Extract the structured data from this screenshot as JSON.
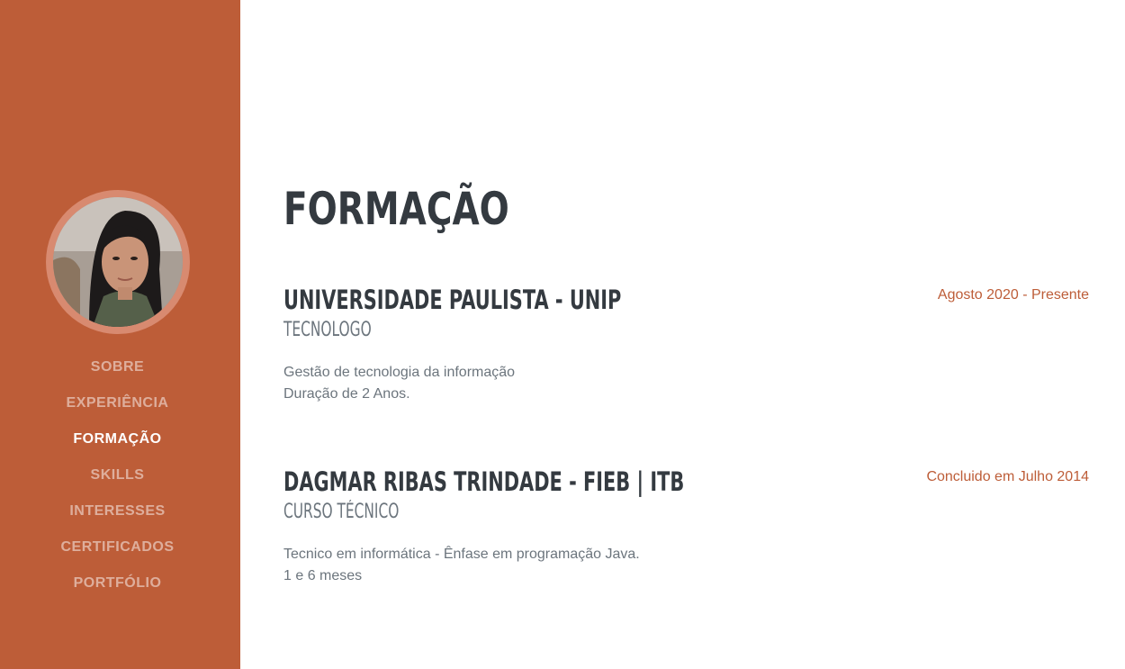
{
  "sidebar": {
    "avatar_alt": "profile photo",
    "nav": [
      {
        "label": "SOBRE"
      },
      {
        "label": "EXPERIÊNCIA"
      },
      {
        "label": "FORMAÇÃO"
      },
      {
        "label": "SKILLS"
      },
      {
        "label": "INTERESSES"
      },
      {
        "label": "CERTIFICADOS"
      },
      {
        "label": "PORTFÓLIO"
      }
    ],
    "active_index": 2
  },
  "main": {
    "title": "FORMAÇÃO",
    "entries": [
      {
        "school": "UNIVERSIDADE PAULISTA - UNIP",
        "degree": "TECNOLOGO",
        "line1": "Gestão de tecnologia da informação",
        "line2": "Duração de 2 Anos.",
        "date": "Agosto 2020 - Presente"
      },
      {
        "school": "DAGMAR RIBAS TRINDADE - FIEB | ITB",
        "degree": "CURSO TÉCNICO",
        "line1": "Tecnico em informática - Ênfase em programação Java.",
        "line2": "1 e 6 meses",
        "date": "Concluido em Julho 2014"
      }
    ]
  },
  "colors": {
    "accent": "#bd5d38",
    "heading": "#343a40",
    "muted": "#6c757d"
  }
}
